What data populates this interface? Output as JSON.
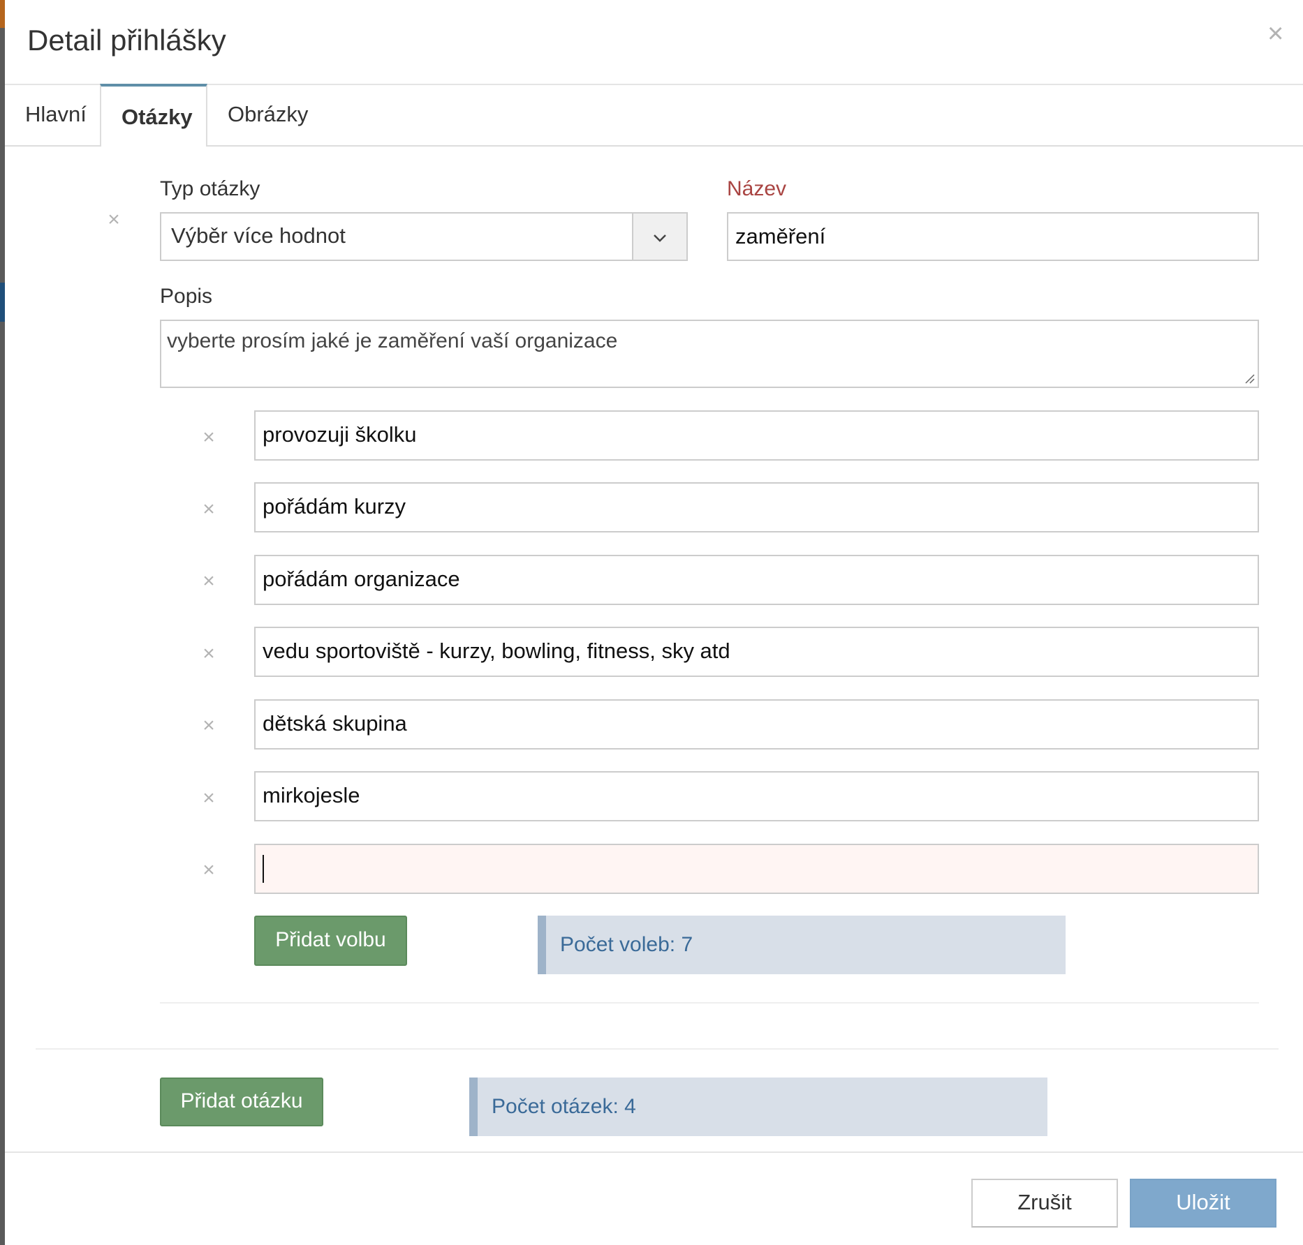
{
  "dialog": {
    "title": "Detail přihlášky",
    "close_glyph": "×"
  },
  "tabs": [
    {
      "label": "Hlavní"
    },
    {
      "label": "Otázky"
    },
    {
      "label": "Obrázky"
    }
  ],
  "question": {
    "remove_glyph": "×",
    "type_label": "Typ otázky",
    "type_value": "Výběr více hodnot",
    "name_label": "Název",
    "name_value": "zaměření",
    "description_label": "Popis",
    "description_value": "vyberte prosím jaké je zaměření vaší organizace",
    "options": [
      {
        "value": "provozuji školku"
      },
      {
        "value": "pořádám kurzy"
      },
      {
        "value": "pořádám organizace"
      },
      {
        "value": "vedu sportoviště - kurzy, bowling, fitness, sky atd"
      },
      {
        "value": "dětská skupina"
      },
      {
        "value": "mirkojesle"
      },
      {
        "value": ""
      }
    ],
    "option_remove_glyph": "×",
    "add_option_label": "Přidat volbu",
    "option_count_text": "Počet voleb: 7"
  },
  "footer_actions": {
    "add_question_label": "Přidat otázku",
    "question_count_text": "Počet otázek: 4"
  },
  "buttons": {
    "cancel": "Zrušit",
    "save": "Uložit"
  },
  "icons": {
    "dropdown": "chevron-down-icon",
    "close": "close-icon",
    "remove": "remove-icon",
    "resize": "resize-handle-icon"
  },
  "colors": {
    "green_button": "#6b9a6b",
    "save_button": "#7fa8cc",
    "info_background": "#d8dfe8",
    "info_text": "#3a6a98",
    "required_label": "#a94442",
    "active_tab_border": "#5f8fa8",
    "invalid_field": "#fff5f3"
  }
}
